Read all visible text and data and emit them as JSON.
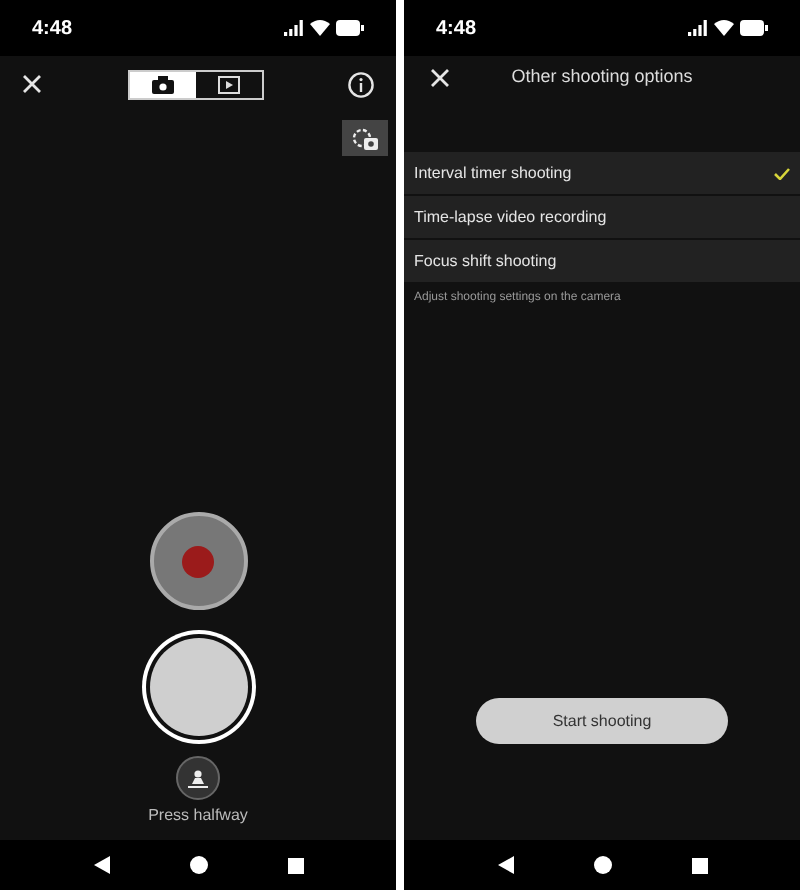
{
  "screens": [
    {
      "kind": "camera",
      "status_bar": {
        "time": "4:48"
      },
      "mode_toggle": [
        {
          "kind": "photo",
          "selected": true
        },
        {
          "kind": "video",
          "selected": false
        }
      ],
      "hint": "Press halfway"
    },
    {
      "kind": "options",
      "status_bar": {
        "time": "4:48"
      },
      "title": "Other shooting options",
      "options": [
        {
          "label": "Interval timer shooting",
          "selected": true
        },
        {
          "label": "Time-lapse video recording",
          "selected": false
        },
        {
          "label": "Focus shift shooting",
          "selected": false
        }
      ],
      "caption": "Adjust shooting settings on the camera",
      "button": "Start shooting"
    }
  ]
}
